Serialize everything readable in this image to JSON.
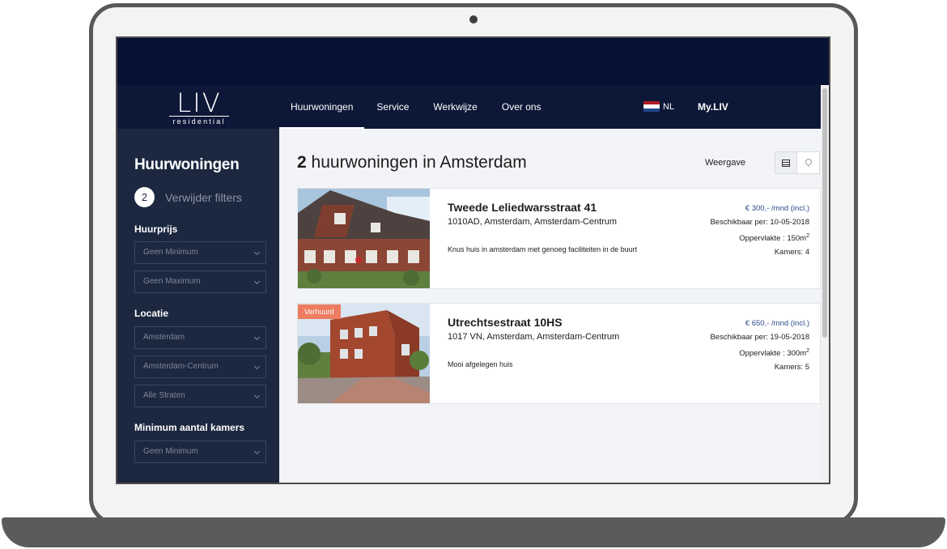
{
  "nav": {
    "items": [
      "Huurwoningen",
      "Service",
      "Werkwijze",
      "Over ons"
    ],
    "language": "NL",
    "account": "My.LIV"
  },
  "logo": {
    "main": "LIV",
    "sub": "residential"
  },
  "sidebar": {
    "title": "Huurwoningen",
    "filter_count": "2",
    "remove_filters": "Verwijder filters",
    "price_label": "Huurprijs",
    "price_min": "Geen Minimum",
    "price_max": "Geen Maximum",
    "location_label": "Locatie",
    "city": "Amsterdam",
    "district": "Amsterdam-Centrum",
    "street": "Alle Straten",
    "rooms_label": "Minimum aantal kamers",
    "rooms_min": "Geen Minimum"
  },
  "main": {
    "count": "2",
    "title_rest": "huurwoningen in Amsterdam",
    "view_label": "Weergave"
  },
  "listings": [
    {
      "name": "Tweede Leliedwarsstraat 41",
      "address": "1010AD, Amsterdam, Amsterdam-Centrum",
      "description": "Knus huis in amsterdam met genoeg faciliteiten in de buurt",
      "price": "€ 300,- /mnd (incl.)",
      "available": "Beschikbaar per: 10-05-2018",
      "area": "Oppervlakte : 150m",
      "area_unit": "2",
      "rooms": "Kamers: 4",
      "badge": ""
    },
    {
      "name": "Utrechtsestraat 10HS",
      "address": "1017 VN, Amsterdam, Amsterdam-Centrum",
      "description": "Mooi afgelegen huis",
      "price": "€ 650,- /mnd (incl.)",
      "available": "Beschikbaar per: 19-05-2018",
      "area": "Oppervlakte : 300m",
      "area_unit": "2",
      "rooms": "Kamers: 5",
      "badge": "Verhuurd"
    }
  ],
  "colors": {
    "navy": "#061133",
    "nav_bar": "#0d1838",
    "sidebar": "#1c2740",
    "accent_badge": "#ed7d62",
    "price_text": "#2a4a8b"
  }
}
